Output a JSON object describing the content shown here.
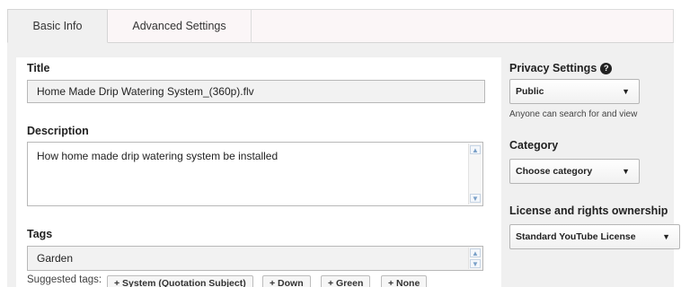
{
  "tabs": [
    {
      "label": "Basic Info"
    },
    {
      "label": "Advanced Settings"
    }
  ],
  "title_section": {
    "label": "Title",
    "value": "Home Made Drip Watering System_(360p).flv"
  },
  "description_section": {
    "label": "Description",
    "value": "How home made drip watering system be installed"
  },
  "tags_section": {
    "label": "Tags",
    "value": "Garden",
    "suggested_label": "Suggested tags:",
    "suggested": [
      "+ System (Quotation Subject)",
      "+ Down",
      "+ Green",
      "+ None"
    ]
  },
  "privacy": {
    "label": "Privacy Settings",
    "help_icon": "question-circle-icon",
    "selected": "Public",
    "hint": "Anyone can search for and view"
  },
  "category": {
    "label": "Category",
    "selected": "Choose category"
  },
  "license": {
    "label": "License and rights ownership",
    "selected": "Standard YouTube License"
  }
}
